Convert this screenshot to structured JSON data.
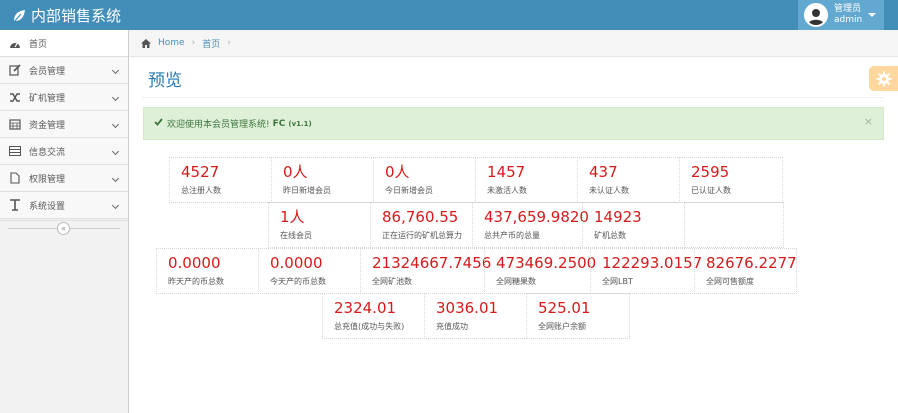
{
  "app": {
    "title": "内部销售系统"
  },
  "user": {
    "role": "管理员",
    "name": "admin"
  },
  "sidebar": {
    "items": [
      {
        "label": "首页",
        "icon": "dashboard-icon"
      },
      {
        "label": "会员管理",
        "icon": "edit-icon"
      },
      {
        "label": "矿机管理",
        "icon": "shuffle-icon"
      },
      {
        "label": "资金管理",
        "icon": "calendar-icon"
      },
      {
        "label": "信息交流",
        "icon": "list-icon"
      },
      {
        "label": "权限管理",
        "icon": "file-icon"
      },
      {
        "label": "系统设置",
        "icon": "text-icon"
      }
    ],
    "collapse_icon": "«"
  },
  "breadcrumb": {
    "home": "Home",
    "current": "首页",
    "sep": "›"
  },
  "page": {
    "title": "预览"
  },
  "alert": {
    "text": "欢迎使用本会员管理系统!",
    "brand": "FC",
    "version": "(v1.1)",
    "close": "×"
  },
  "stats": [
    {
      "value": "4527",
      "label": "总注册人数"
    },
    {
      "value": "0人",
      "label": "昨日新增会员"
    },
    {
      "value": "0人",
      "label": "今日新增会员"
    },
    {
      "value": "1457",
      "label": "未激活人数"
    },
    {
      "value": "437",
      "label": "未认证人数"
    },
    {
      "value": "2595",
      "label": "已认证人数"
    },
    {
      "value": "1人",
      "label": "在线会员"
    },
    {
      "value": "86,760.55",
      "label": "正在运行的矿机总算力"
    },
    {
      "value": "437,659.9820",
      "label": "总共产币的总量"
    },
    {
      "value": "14923",
      "label": "矿机总数"
    },
    {
      "value": "",
      "label": ""
    },
    {
      "value": "0.0000",
      "label": "昨天产的币总数"
    },
    {
      "value": "0.0000",
      "label": "今天产的币总数"
    },
    {
      "value": "21324667.7456",
      "label": "全网矿池数"
    },
    {
      "value": "473469.2500",
      "label": "全网糖果数"
    },
    {
      "value": "122293.0157",
      "label": "全网LBT"
    },
    {
      "value": "82676.2277",
      "label": "全网可售额度"
    },
    {
      "value": "2324.01",
      "label": "总充值(成功与失败)"
    },
    {
      "value": "3036.01",
      "label": "充值成功"
    },
    {
      "value": "525.01",
      "label": "全网账户余额"
    }
  ]
}
